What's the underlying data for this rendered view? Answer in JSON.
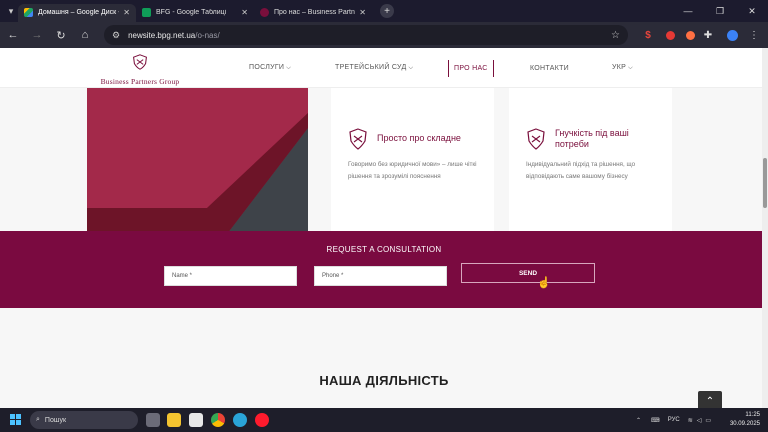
{
  "browser": {
    "tabs": [
      {
        "title": "Домашня – Google Диск -",
        "favicon_color": "#1fa463",
        "active": true
      },
      {
        "title": "BFG - Google Таблиці",
        "favicon_color": "#0f9d58",
        "active": false
      },
      {
        "title": "Про нас – Business Partners",
        "favicon_color": "#7a0f3c",
        "active": false
      }
    ],
    "url_host": "newsite.bpg.net.ua",
    "url_path": "/o-nas/"
  },
  "site": {
    "logo_text": "Business Partners Group",
    "menu": [
      {
        "label": "ПОСЛУГИ",
        "has_dropdown": true
      },
      {
        "label": "ТРЕТЕЙСЬКИЙ СУД",
        "has_dropdown": true
      },
      {
        "label": "ПРО НАС",
        "has_dropdown": false,
        "active": true
      },
      {
        "label": "КОНТАКТИ",
        "has_dropdown": false
      },
      {
        "label": "УКР",
        "has_dropdown": true
      }
    ],
    "features": [
      {
        "title": "Просто про складне",
        "description": "Говоримо без юридичної мови» – лише чіткі рішення та зрозумілі пояснення"
      },
      {
        "title": "Гнучкість під ваші потреби",
        "description": "Індивідуальний підхід та рішення, що відповідають саме вашому бізнесу"
      }
    ],
    "consultation": {
      "heading": "REQUEST A CONSULTATION",
      "name_placeholder": "Name *",
      "phone_placeholder": "Phone *",
      "send_label": "SEND"
    },
    "activity_heading": "НАША ДІЯЛЬНІСТЬ",
    "brand_color": "#7a0a40"
  },
  "taskbar": {
    "search_label": "Пошук",
    "language": "РУС",
    "time": "11:25",
    "date": "30.09.2025"
  }
}
